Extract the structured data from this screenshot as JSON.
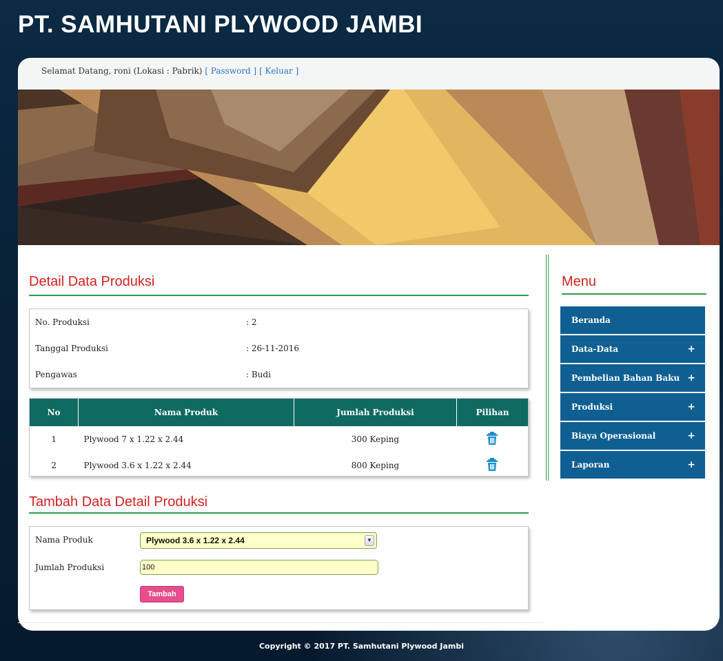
{
  "site": {
    "title": "PT. SAMHUTANI PLYWOOD JAMBI"
  },
  "welcome": {
    "text": "Selamat Datang, roni (Lokasi : Pabrik)",
    "password_link": "[ Password ]",
    "logout_link": "[ Keluar ]"
  },
  "detail": {
    "title": "Detail Data Produksi",
    "fields": [
      {
        "label": "No. Produksi",
        "value": ": 2"
      },
      {
        "label": "Tanggal Produksi",
        "value": ": 26-11-2016"
      },
      {
        "label": "Pengawas",
        "value": ": Budi"
      }
    ]
  },
  "table": {
    "headers": [
      "No",
      "Nama Produk",
      "Jumlah Produksi",
      "Pilihan"
    ],
    "rows": [
      {
        "no": "1",
        "name": "Plywood 7 x 1.22 x 2.44",
        "qty": "300 Keping",
        "action_icon": "trash-icon"
      },
      {
        "no": "2",
        "name": "Plywood 3.6 x 1.22 x 2.44",
        "qty": "800 Keping",
        "action_icon": "trash-icon"
      }
    ]
  },
  "form": {
    "title": "Tambah Data Detail Produksi",
    "product_label": "Nama Produk",
    "product_selected": "Plywood 3.6 x 1.22 x 2.44",
    "qty_label": "Jumlah Produksi",
    "qty_value": "100",
    "submit_label": "Tambah"
  },
  "menu": {
    "title": "Menu",
    "items": [
      {
        "label": "Beranda",
        "has_sub": false
      },
      {
        "label": "Data-Data",
        "has_sub": true
      },
      {
        "label": "Pembelian Bahan Baku",
        "has_sub": true
      },
      {
        "label": "Produksi",
        "has_sub": true
      },
      {
        "label": "Biaya Operasional",
        "has_sub": true
      },
      {
        "label": "Laporan",
        "has_sub": true
      }
    ],
    "expand_symbol": "+"
  },
  "footer": {
    "text": "Copyright © 2017 PT. Samhutani Plywood Jambi"
  },
  "colors": {
    "accent_red": "#d42020",
    "rule_green": "#2f9a48",
    "table_header": "#0f6a62",
    "menu_blue": "#0f5f92",
    "button_pink": "#e64f8e",
    "input_yellow": "#ffffc8"
  }
}
